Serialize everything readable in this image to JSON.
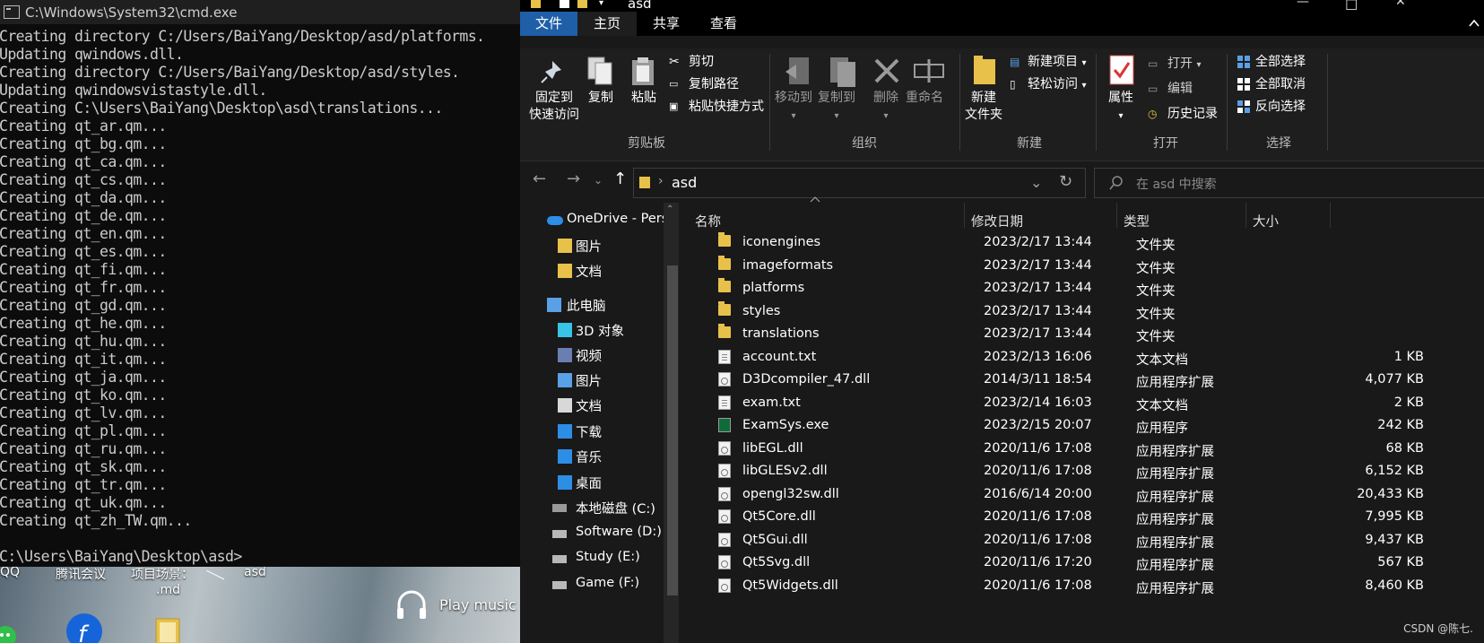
{
  "cmd": {
    "title": "C:\\Windows\\System32\\cmd.exe",
    "lines": [
      "Creating directory C:/Users/BaiYang/Desktop/asd/platforms.",
      "Updating qwindows.dll.",
      "Creating directory C:/Users/BaiYang/Desktop/asd/styles.",
      "Updating qwindowsvistastyle.dll.",
      "Creating C:\\Users\\BaiYang\\Desktop\\asd\\translations...",
      "Creating qt_ar.qm...",
      "Creating qt_bg.qm...",
      "Creating qt_ca.qm...",
      "Creating qt_cs.qm...",
      "Creating qt_da.qm...",
      "Creating qt_de.qm...",
      "Creating qt_en.qm...",
      "Creating qt_es.qm...",
      "Creating qt_fi.qm...",
      "Creating qt_fr.qm...",
      "Creating qt_gd.qm...",
      "Creating qt_he.qm...",
      "Creating qt_hu.qm...",
      "Creating qt_it.qm...",
      "Creating qt_ja.qm...",
      "Creating qt_ko.qm...",
      "Creating qt_lv.qm...",
      "Creating qt_pl.qm...",
      "Creating qt_ru.qm...",
      "Creating qt_sk.qm...",
      "Creating qt_tr.qm...",
      "Creating qt_uk.qm...",
      "Creating qt_zh_TW.qm...",
      "",
      "C:\\Users\\BaiYang\\Desktop\\asd>"
    ]
  },
  "desktop": {
    "labels": [
      "QQ",
      "腾讯会议",
      "项目场景：",
      ".md",
      "asd",
      "Play music"
    ]
  },
  "explorer": {
    "title": "asd",
    "tabs": {
      "file": "文件",
      "home": "主页",
      "share": "共享",
      "view": "查看"
    },
    "ribbon": {
      "pin": [
        "固定到",
        "快速访问"
      ],
      "copy": "复制",
      "paste": "粘贴",
      "cut": "剪切",
      "copy_path": "复制路径",
      "paste_shortcut": "粘贴快捷方式",
      "move_to": "移动到",
      "copy_to": "复制到",
      "delete": "删除",
      "rename": "重命名",
      "new_folder": [
        "新建",
        "文件夹"
      ],
      "new_item": "新建项目",
      "easy_access": "轻松访问",
      "properties": "属性",
      "open": "打开",
      "edit": "编辑",
      "history": "历史记录",
      "select_all": "全部选择",
      "select_none": "全部取消",
      "invert_selection": "反向选择",
      "groups": {
        "clipboard": "剪贴板",
        "organize": "组织",
        "new": "新建",
        "open": "打开",
        "select": "选择"
      }
    },
    "address": {
      "crumb": "asd"
    },
    "search": {
      "placeholder": "在 asd 中搜索"
    },
    "nav": [
      {
        "label": "OneDrive - Perso",
        "icon": "cloud-icon"
      },
      {
        "label": "图片",
        "icon": "folder-icon"
      },
      {
        "label": "文档",
        "icon": "folder-icon"
      },
      {
        "label": "此电脑",
        "icon": "computer-icon"
      },
      {
        "label": "3D 对象",
        "icon": "cube-icon"
      },
      {
        "label": "视频",
        "icon": "film-icon"
      },
      {
        "label": "图片",
        "icon": "picture-icon"
      },
      {
        "label": "文档",
        "icon": "document-icon"
      },
      {
        "label": "下载",
        "icon": "download-icon"
      },
      {
        "label": "音乐",
        "icon": "music-icon"
      },
      {
        "label": "桌面",
        "icon": "desktop-icon"
      },
      {
        "label": "本地磁盘 (C:)",
        "icon": "windows-drive-icon"
      },
      {
        "label": "Software (D:)",
        "icon": "drive-icon"
      },
      {
        "label": "Study (E:)",
        "icon": "drive-icon"
      },
      {
        "label": "Game (F:)",
        "icon": "drive-icon"
      }
    ],
    "columns": {
      "name": "名称",
      "date": "修改日期",
      "type": "类型",
      "size": "大小"
    },
    "files": [
      {
        "name": "iconengines",
        "date": "2023/2/17 13:44",
        "type": "文件夹",
        "size": "",
        "icon": "folder"
      },
      {
        "name": "imageformats",
        "date": "2023/2/17 13:44",
        "type": "文件夹",
        "size": "",
        "icon": "folder"
      },
      {
        "name": "platforms",
        "date": "2023/2/17 13:44",
        "type": "文件夹",
        "size": "",
        "icon": "folder"
      },
      {
        "name": "styles",
        "date": "2023/2/17 13:44",
        "type": "文件夹",
        "size": "",
        "icon": "folder"
      },
      {
        "name": "translations",
        "date": "2023/2/17 13:44",
        "type": "文件夹",
        "size": "",
        "icon": "folder"
      },
      {
        "name": "account.txt",
        "date": "2023/2/13 16:06",
        "type": "文本文档",
        "size": "1 KB",
        "icon": "doc"
      },
      {
        "name": "D3Dcompiler_47.dll",
        "date": "2014/3/11 18:54",
        "type": "应用程序扩展",
        "size": "4,077 KB",
        "icon": "dll"
      },
      {
        "name": "exam.txt",
        "date": "2023/2/14 16:03",
        "type": "文本文档",
        "size": "2 KB",
        "icon": "doc"
      },
      {
        "name": "ExamSys.exe",
        "date": "2023/2/15 20:07",
        "type": "应用程序",
        "size": "242 KB",
        "icon": "exe"
      },
      {
        "name": "libEGL.dll",
        "date": "2020/11/6 17:08",
        "type": "应用程序扩展",
        "size": "68 KB",
        "icon": "dll"
      },
      {
        "name": "libGLESv2.dll",
        "date": "2020/11/6 17:08",
        "type": "应用程序扩展",
        "size": "6,152 KB",
        "icon": "dll"
      },
      {
        "name": "opengl32sw.dll",
        "date": "2016/6/14 20:00",
        "type": "应用程序扩展",
        "size": "20,433 KB",
        "icon": "dll"
      },
      {
        "name": "Qt5Core.dll",
        "date": "2020/11/6 17:08",
        "type": "应用程序扩展",
        "size": "7,995 KB",
        "icon": "dll"
      },
      {
        "name": "Qt5Gui.dll",
        "date": "2020/11/6 17:08",
        "type": "应用程序扩展",
        "size": "9,437 KB",
        "icon": "dll"
      },
      {
        "name": "Qt5Svg.dll",
        "date": "2020/11/6 17:20",
        "type": "应用程序扩展",
        "size": "567 KB",
        "icon": "dll"
      },
      {
        "name": "Qt5Widgets.dll",
        "date": "2020/11/6 17:08",
        "type": "应用程序扩展",
        "size": "8,460 KB",
        "icon": "dll"
      }
    ]
  },
  "watermark": "CSDN @陈七."
}
